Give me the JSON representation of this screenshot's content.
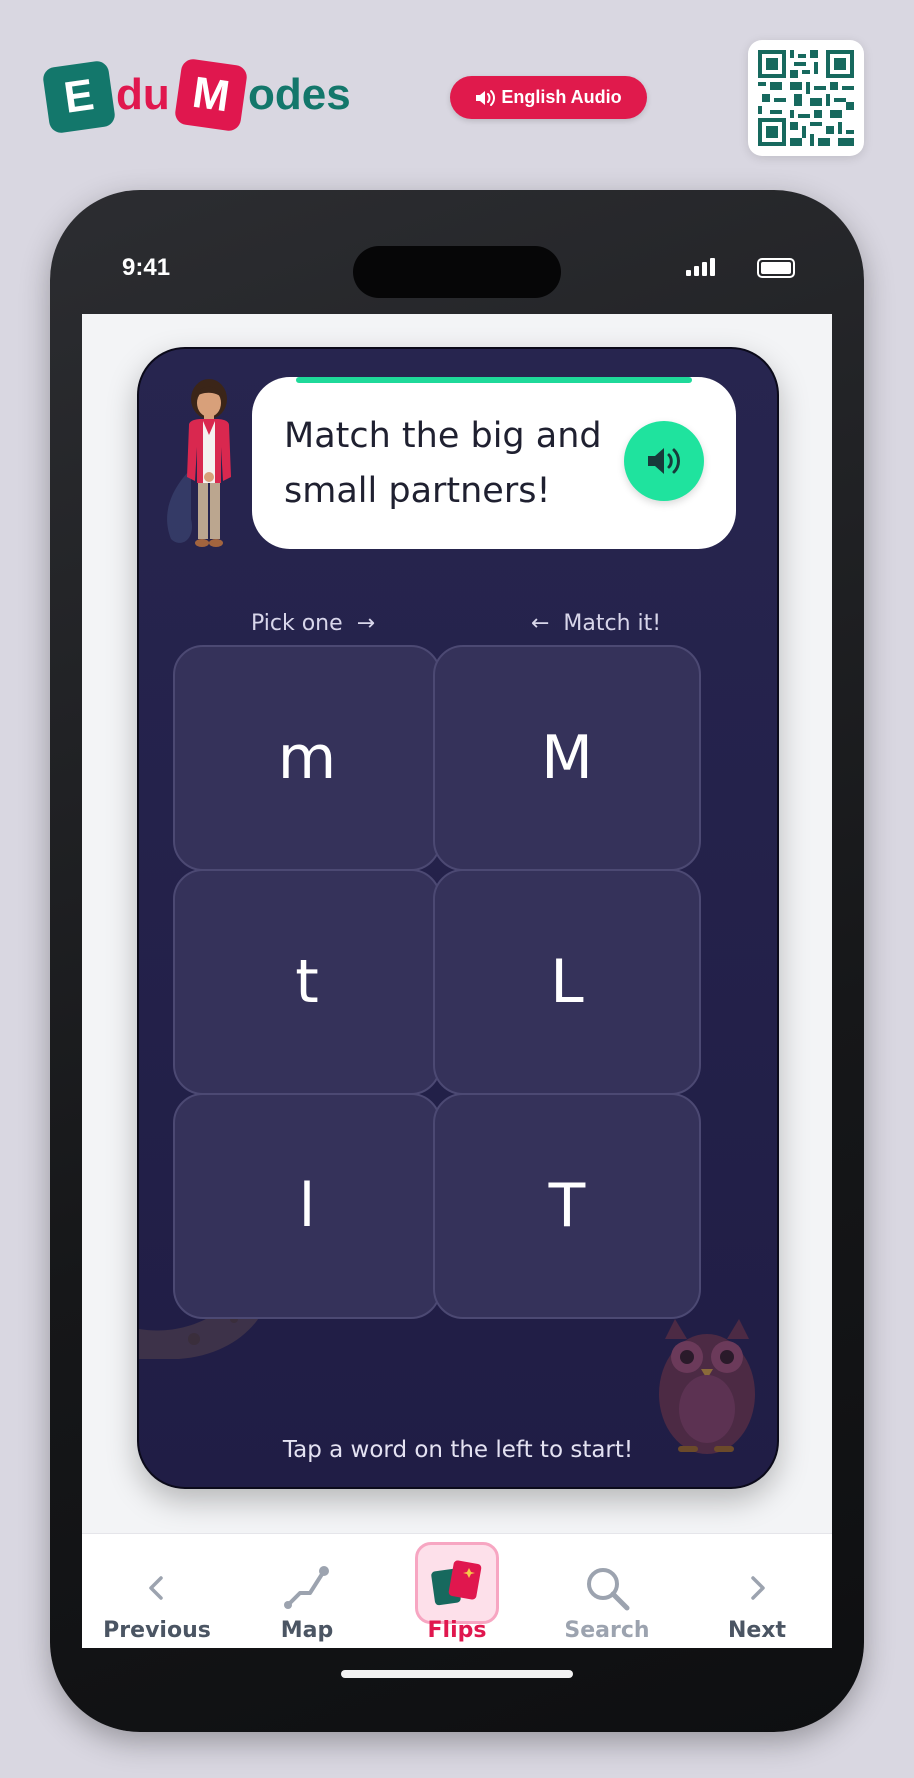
{
  "header": {
    "logo_tile_e": "E",
    "logo_word_du": "du",
    "logo_tile_m": "M",
    "logo_word_odes": "odes",
    "audio_button_label": "English Audio",
    "qr_icon": "qr-code"
  },
  "status_bar": {
    "time": "9:41",
    "signal_icon": "cellular-signal",
    "battery_icon": "battery-full"
  },
  "game": {
    "prompt": "Match the big and small partners!",
    "speak_icon": "speaker",
    "hint_left": "Pick one  →",
    "hint_right": "←  Match it!",
    "left_tiles": [
      "m",
      "t",
      "l"
    ],
    "right_tiles": [
      "M",
      "L",
      "T"
    ],
    "footer_note": "Tap a word on the left to start!",
    "colors": {
      "accent": "#1fe39e",
      "card_bg": "#27254f",
      "tile_bg": "#35325a"
    }
  },
  "nav": {
    "items": [
      {
        "label": "Previous",
        "icon": "chevron-left",
        "color": "#4b5563"
      },
      {
        "label": "Map",
        "icon": "route",
        "color": "#4b5563"
      },
      {
        "label": "Flips",
        "icon": "flashcards",
        "color": "#e0174e",
        "active": true
      },
      {
        "label": "Search",
        "icon": "search",
        "color": "#9ca3af"
      },
      {
        "label": "Next",
        "icon": "chevron-right",
        "color": "#4b5563"
      }
    ]
  }
}
